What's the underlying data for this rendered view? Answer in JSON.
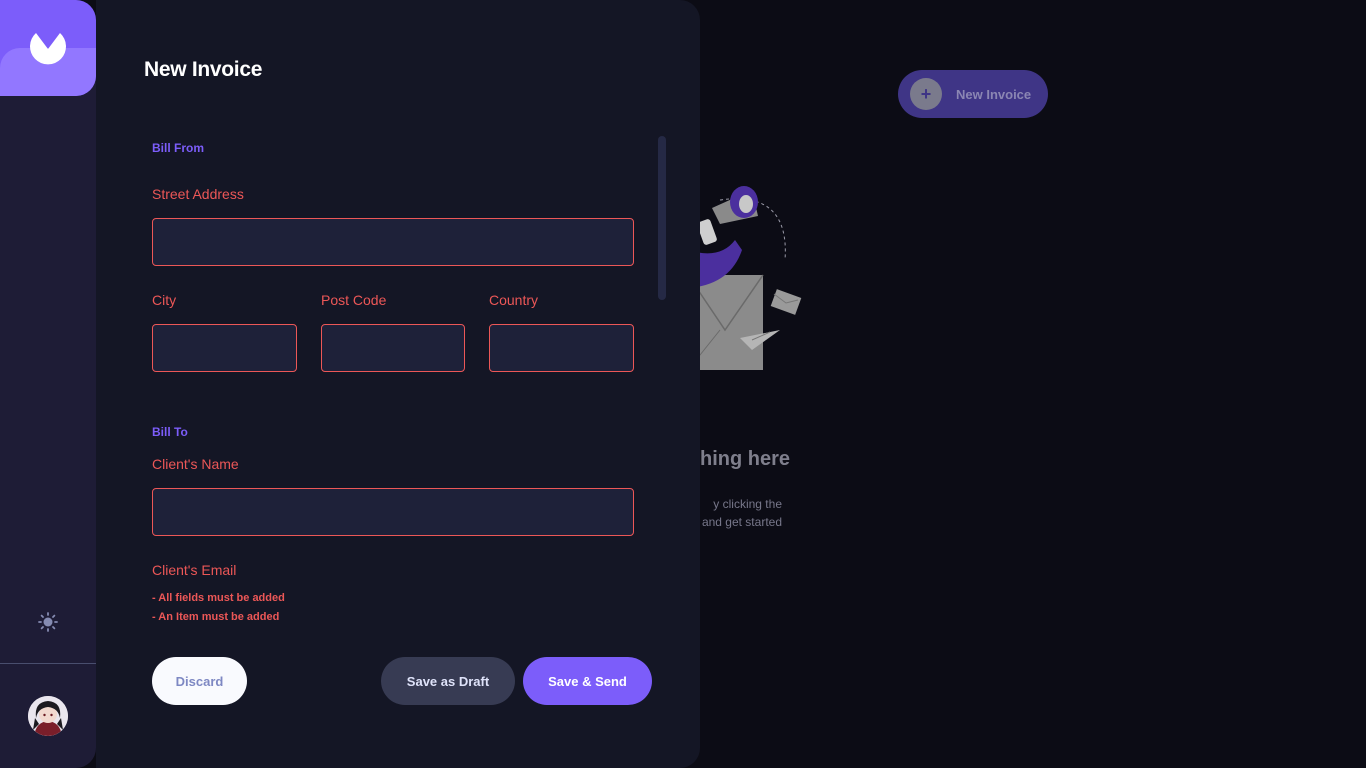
{
  "background": {
    "new_invoice_button": {
      "label": "New Invoice",
      "icon": "plus-icon"
    },
    "empty_state": {
      "title_fragment": "hing here",
      "line1_fragment": "y clicking the",
      "line2_fragment": "and get started"
    }
  },
  "sidebar": {
    "logo_icon": "logo-icon",
    "theme_icon": "sun-icon",
    "avatar": "user-avatar"
  },
  "form": {
    "title": "New Invoice",
    "bill_from": {
      "heading": "Bill From",
      "street_label": "Street Address",
      "street_value": "",
      "city_label": "City",
      "city_value": "",
      "postcode_label": "Post Code",
      "postcode_value": "",
      "country_label": "Country",
      "country_value": ""
    },
    "bill_to": {
      "heading": "Bill To",
      "client_name_label": "Client's Name",
      "client_name_value": "",
      "client_email_label": "Client's Email"
    },
    "errors": [
      "- All fields must be added",
      "- An Item must be added"
    ],
    "buttons": {
      "discard": "Discard",
      "save_draft": "Save as Draft",
      "save_send": "Save & Send"
    }
  },
  "colors": {
    "accent": "#7c5dfa",
    "error": "#ec5757",
    "drawer_bg": "#141625",
    "input_bg": "#1e2139"
  }
}
